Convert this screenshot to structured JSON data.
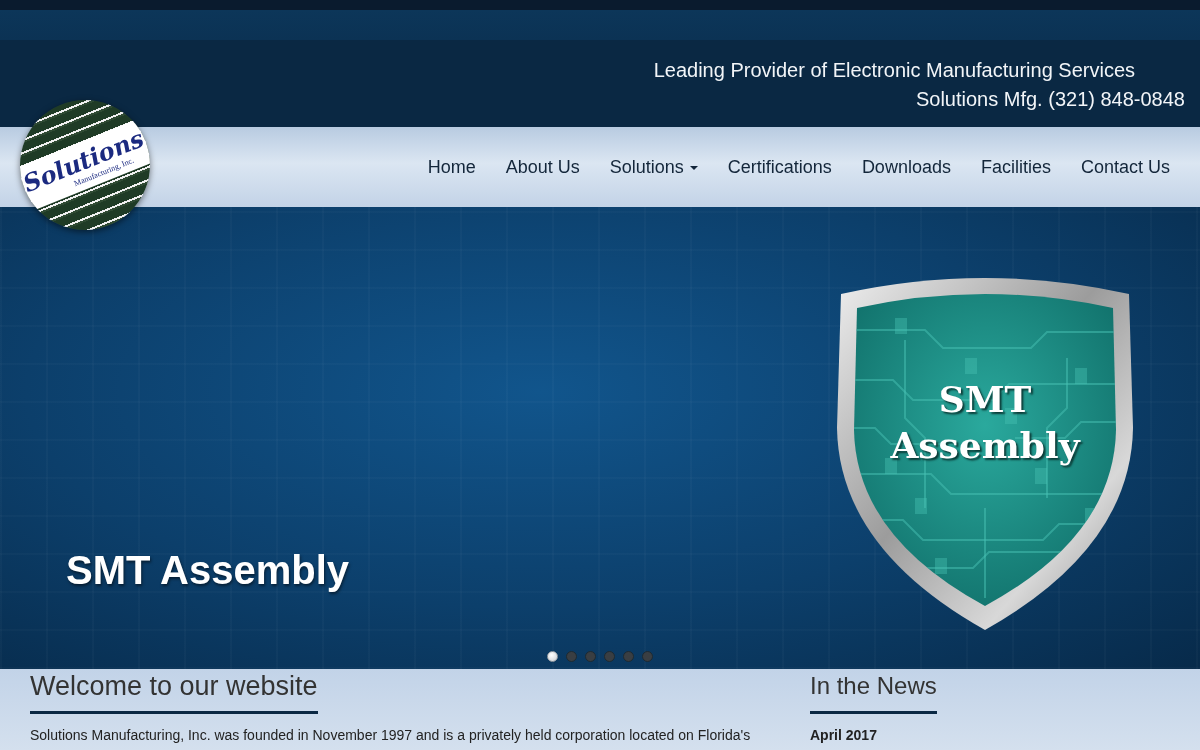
{
  "header": {
    "tagline": "Leading Provider of Electronic Manufacturing Services",
    "phone": "Solutions Mfg. (321) 848-0848"
  },
  "logo": {
    "name": "Solutions",
    "subtitle": "Manufacturing, Inc."
  },
  "nav": {
    "items": [
      {
        "label": "Home",
        "dropdown": false
      },
      {
        "label": "About Us",
        "dropdown": false
      },
      {
        "label": "Solutions",
        "dropdown": true
      },
      {
        "label": "Certifications",
        "dropdown": false
      },
      {
        "label": "Downloads",
        "dropdown": false
      },
      {
        "label": "Facilities",
        "dropdown": false
      },
      {
        "label": "Contact Us",
        "dropdown": false
      }
    ]
  },
  "carousel": {
    "caption": "SMT Assembly",
    "badge_text": "SMT Assembly",
    "indicators": [
      {
        "selected": true
      },
      {
        "selected": false
      },
      {
        "selected": false
      },
      {
        "selected": false
      },
      {
        "selected": false
      },
      {
        "selected": false
      }
    ]
  },
  "welcome": {
    "heading": "Welcome to our website",
    "text": "Solutions Manufacturing, Inc. was founded in November 1997 and is a privately held corporation located on Florida's"
  },
  "news": {
    "heading": "In the News",
    "items": [
      {
        "date": "April 2017"
      }
    ]
  }
}
